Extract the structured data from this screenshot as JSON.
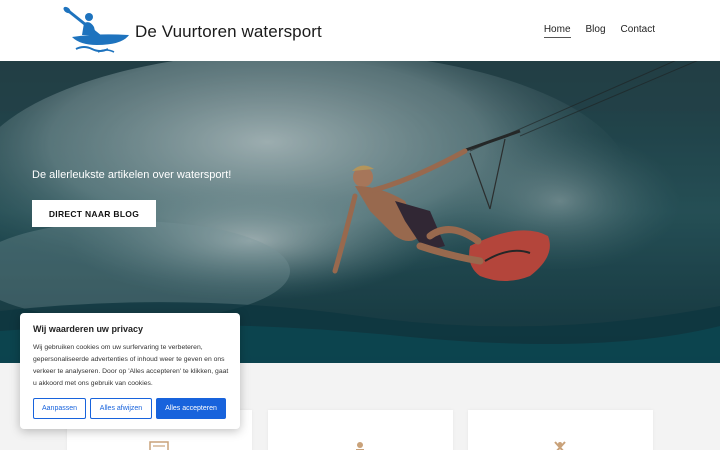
{
  "site": {
    "title": "De Vuurtoren watersport",
    "logo_icon": "kayaker-logo-icon"
  },
  "nav": {
    "items": [
      {
        "label": "Home",
        "active": true
      },
      {
        "label": "Blog",
        "active": false
      },
      {
        "label": "Contact",
        "active": false
      }
    ]
  },
  "hero": {
    "tagline": "De allerleukste artikelen over watersport!",
    "button_label": "DIRECT NAAR BLOG",
    "image": "kitesurfer-photo"
  },
  "cookie": {
    "title": "Wij waarderen uw privacy",
    "text": "Wij gebruiken cookies om uw surfervaring te verbeteren, gepersonaliseerde advertenties of inhoud weer te geven en ons verkeer te analyseren. Door op 'Alles accepteren' te klikken, gaat u akkoord met ons gebruik van cookies.",
    "customize_label": "Aanpassen",
    "reject_label": "Alles afwijzen",
    "accept_label": "Alles accepteren",
    "accent_color": "#1863dc"
  },
  "cards": {
    "icons": [
      "newspaper-icon",
      "person-icon",
      "sport-icon"
    ],
    "icon_color": "#c9a27a"
  }
}
